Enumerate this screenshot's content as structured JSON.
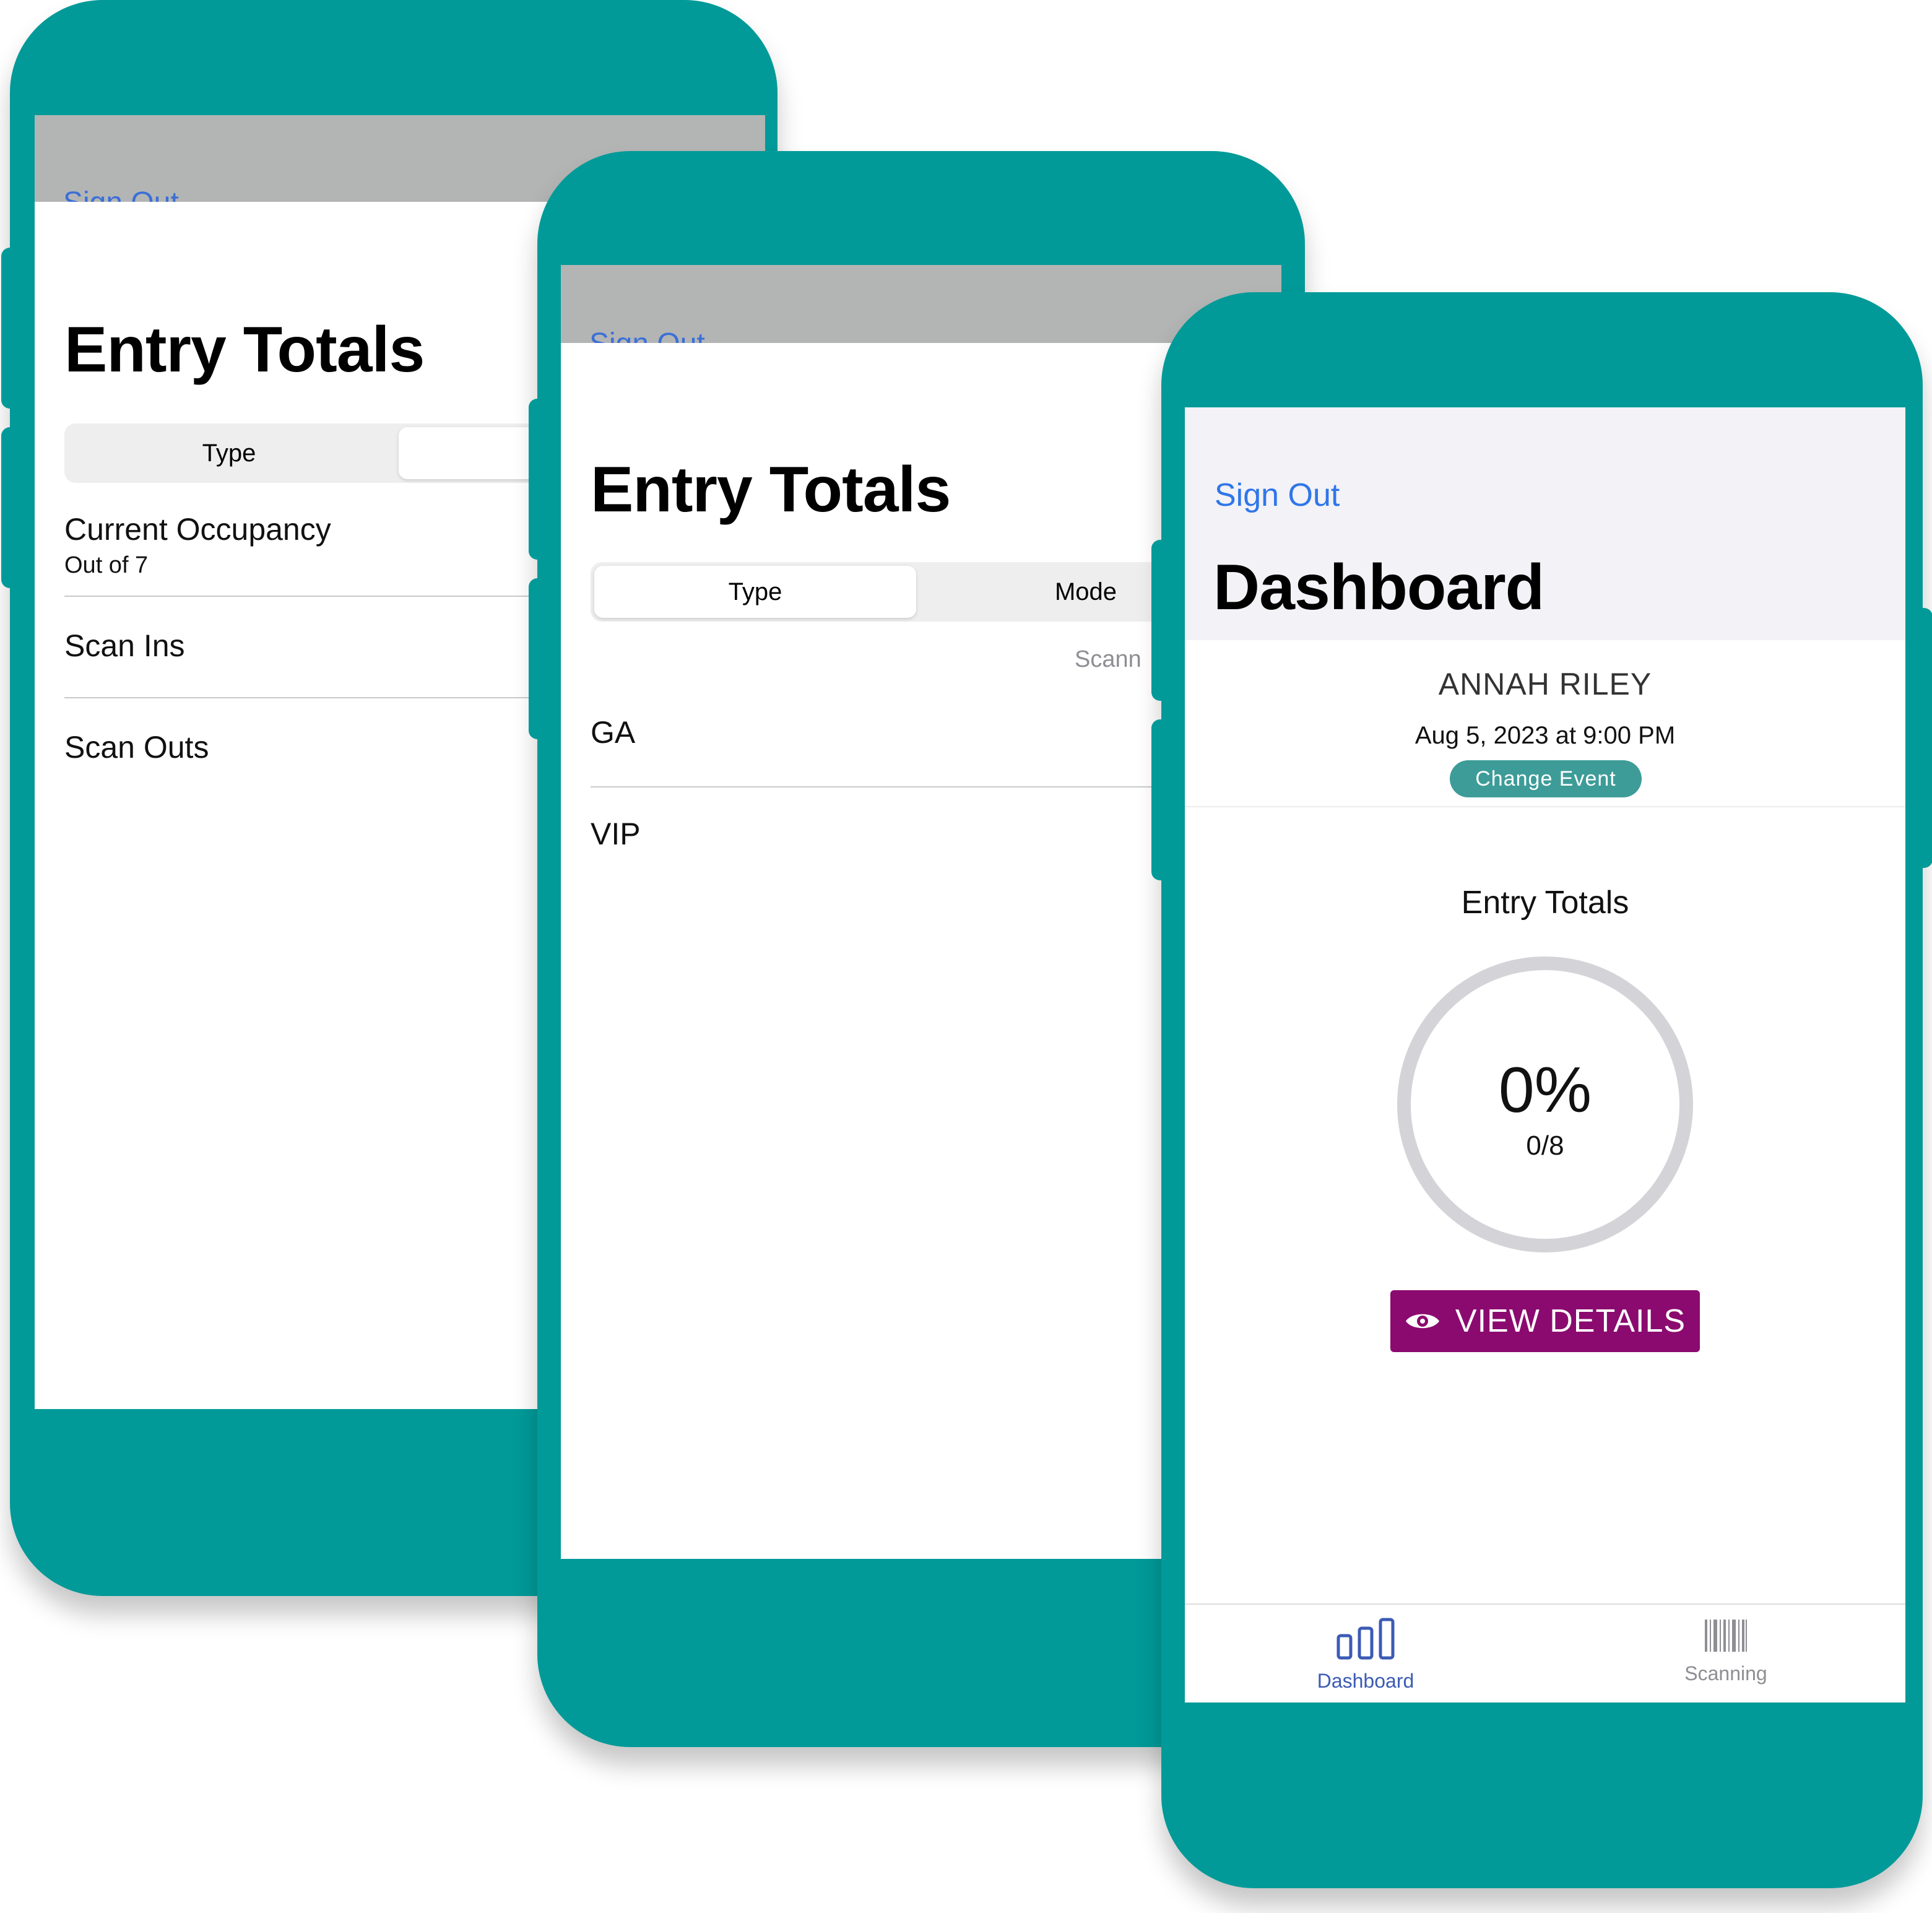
{
  "back_phone": {
    "peek_text": "Sign Out",
    "title": "Entry Totals",
    "segments": [
      "Type",
      ""
    ],
    "rows": [
      {
        "label": "Current Occupancy",
        "sub": "Out of 7"
      },
      {
        "label": "Scan Ins"
      },
      {
        "label": "Scan Outs"
      }
    ]
  },
  "middle_phone": {
    "peek_text": "Sign Out",
    "title": "Entry Totals",
    "segments": [
      "Type",
      "Mode"
    ],
    "column_header": "Scann",
    "rows": [
      {
        "label": "GA"
      },
      {
        "label": "VIP"
      }
    ]
  },
  "front_phone": {
    "sign_out": "Sign Out",
    "title": "Dashboard",
    "user_name": "ANNAH RILEY",
    "event_date": "Aug 5, 2023 at 9:00 PM",
    "change_event": "Change Event",
    "section_title": "Entry Totals",
    "gauge": {
      "percent_label": "0%",
      "count_label": "0/8",
      "progress": 0
    },
    "view_details": "VIEW DETAILS",
    "tabs": [
      {
        "label": "Dashboard",
        "icon": "bar-chart-icon",
        "active": true
      },
      {
        "label": "Scanning",
        "icon": "barcode-icon",
        "active": false
      }
    ],
    "colors": {
      "phone": "#019a98",
      "link": "#2f76e8",
      "change_event": "#3d9c98",
      "view_details": "#8b0a6f",
      "tab_active": "#3b5bb5",
      "tab_inactive": "#8e8e93"
    }
  }
}
